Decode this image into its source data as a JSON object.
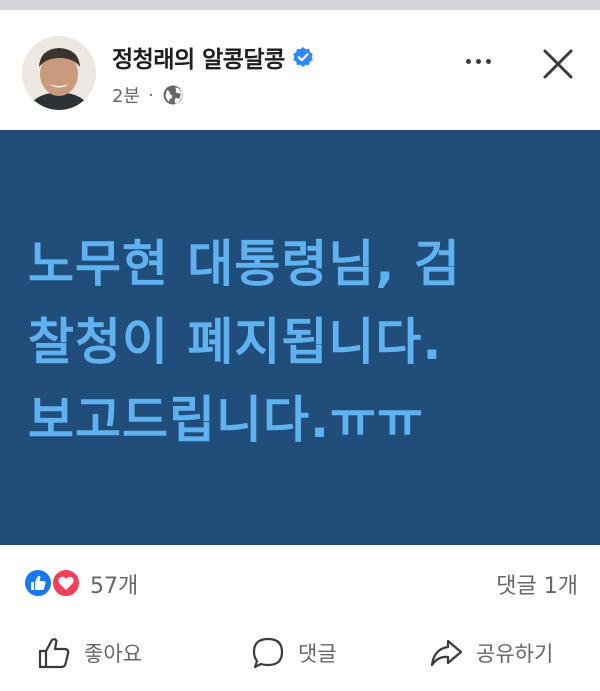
{
  "post": {
    "page_name": "정청래의 알콩달콩",
    "time": "2분",
    "separator": "·",
    "icons": [
      "verified-badge-icon",
      "globe-icon",
      "more-icon",
      "close-icon"
    ]
  },
  "media": {
    "lines": [
      "노무현 대통령님, 검",
      "찰청이 폐지됩니다.",
      "보고드립니다.ㅠㅠ"
    ],
    "background_color": "#204d7a",
    "text_color": "#5fb2ef"
  },
  "reactions": {
    "count": "57개",
    "types": [
      "like",
      "love"
    ],
    "comments": "댓글 1개"
  },
  "actions": {
    "like": "좋아요",
    "comment": "댓글",
    "share": "공유하기"
  }
}
